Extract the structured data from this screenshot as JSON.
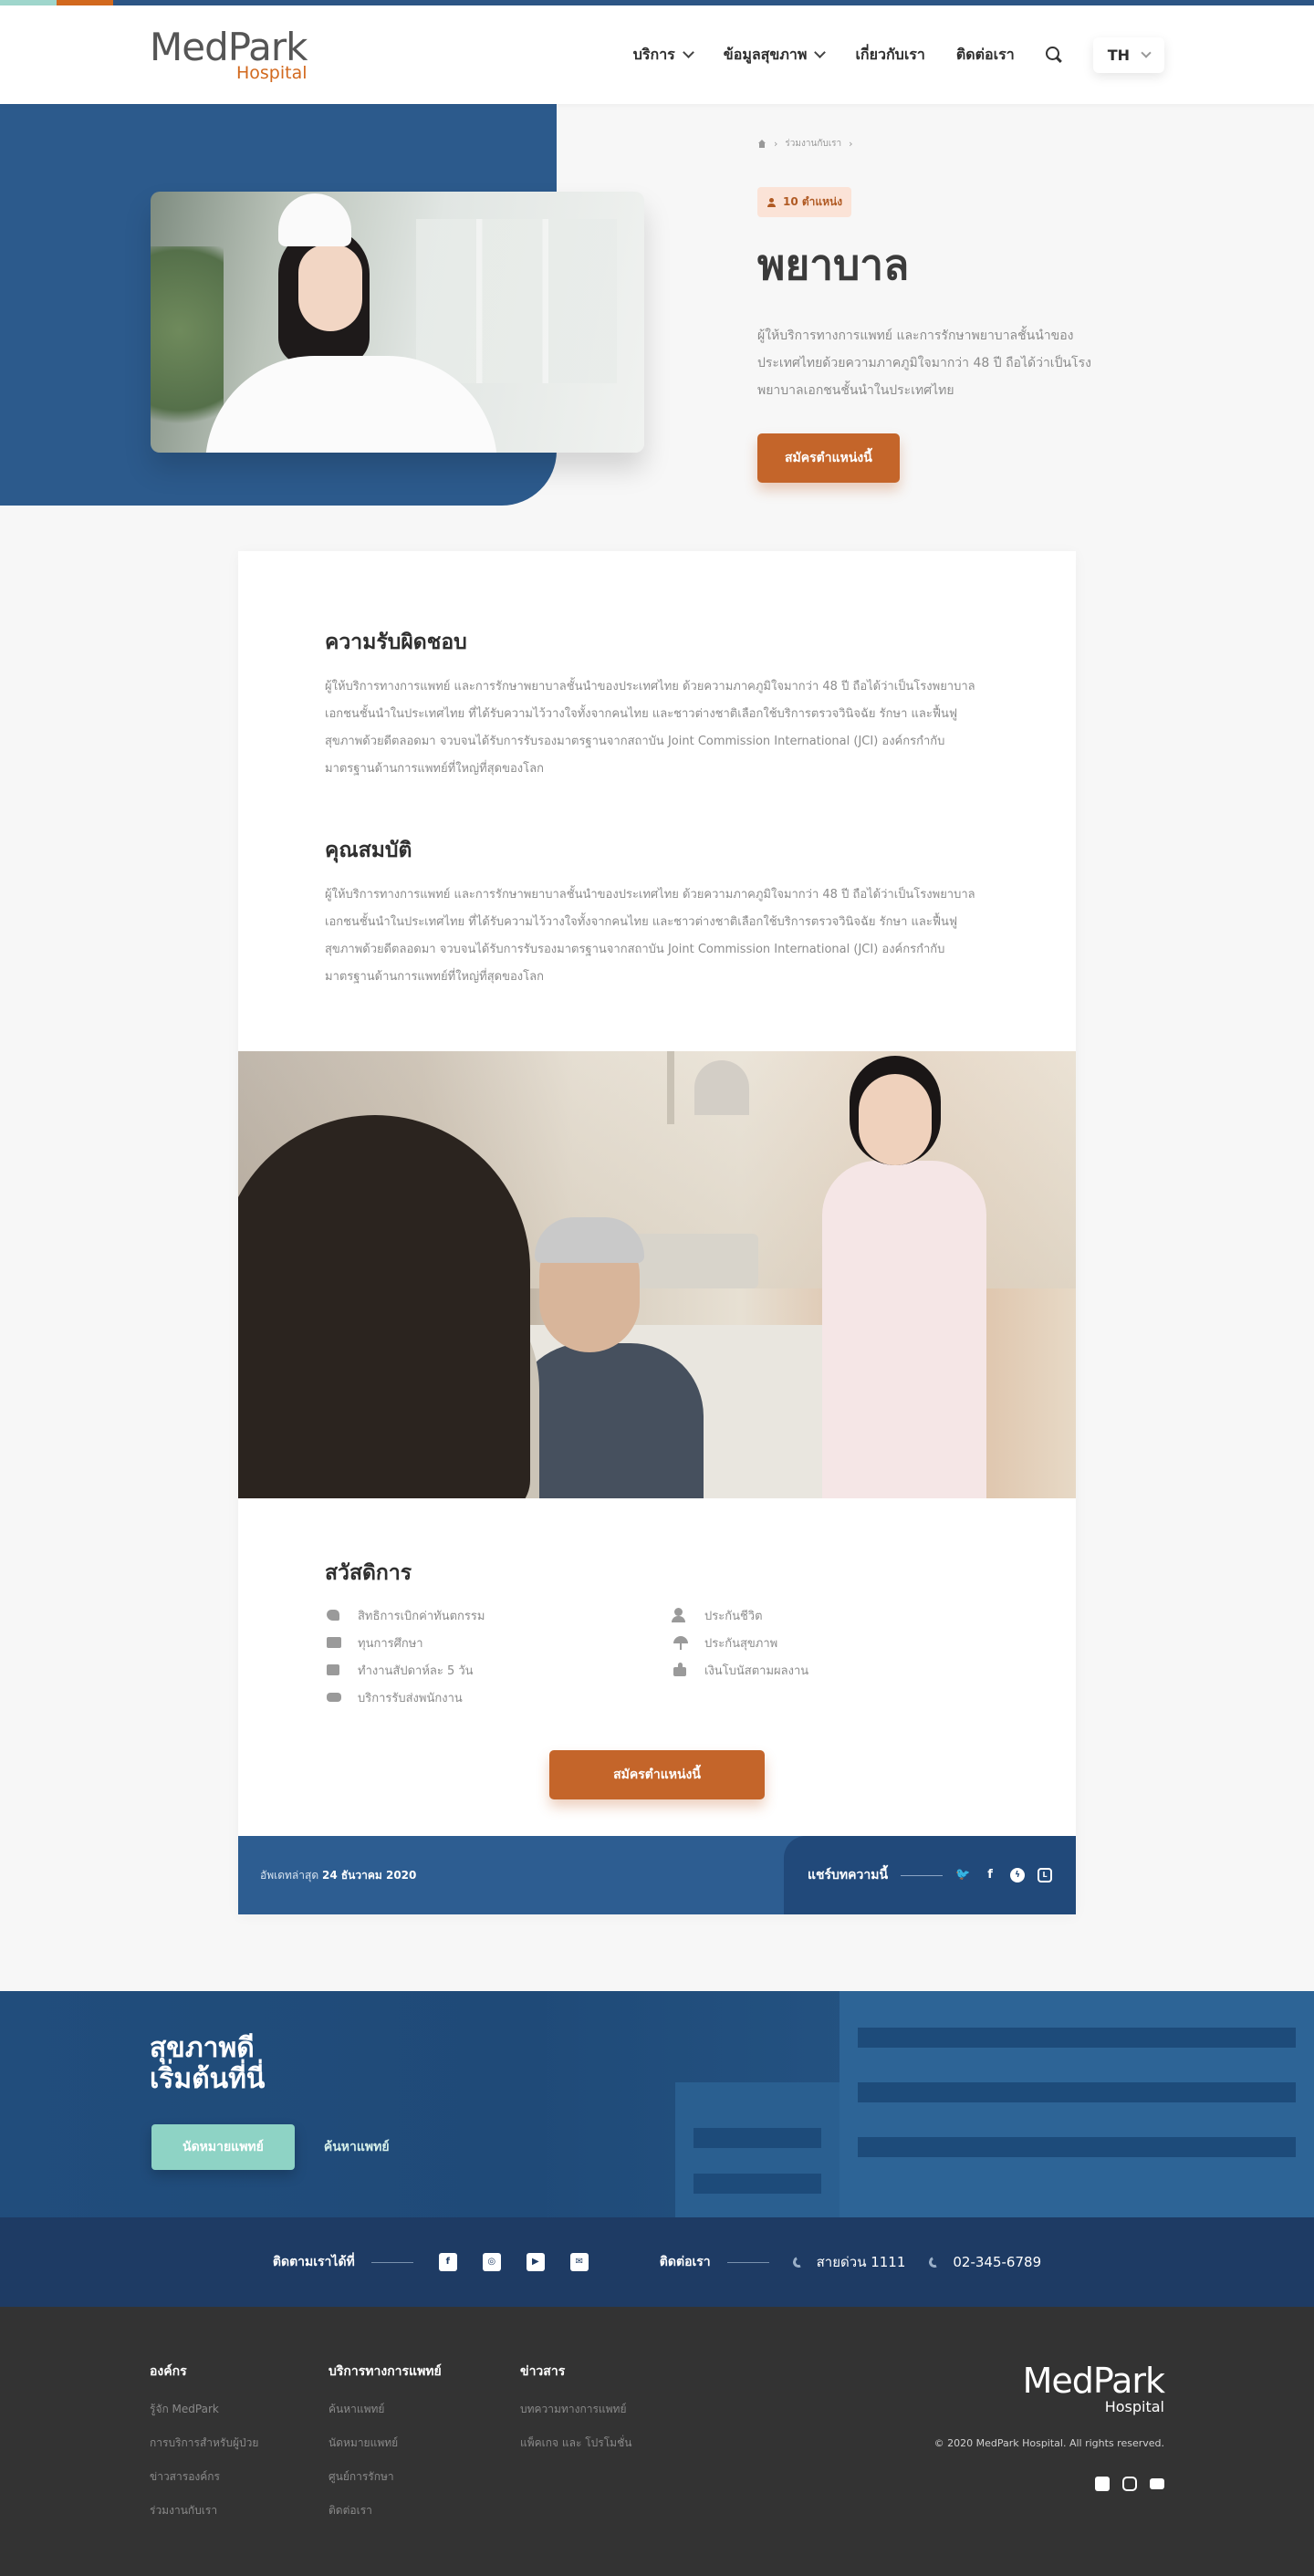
{
  "header": {
    "logo_main": "MedPark",
    "logo_sub": "Hospital",
    "nav": [
      {
        "label": "บริการ"
      },
      {
        "label": "ข้อมูลสุขภาพ"
      },
      {
        "label": "เกี่ยวกับเรา"
      },
      {
        "label": "ติดต่อเรา"
      }
    ],
    "lang": "TH"
  },
  "hero": {
    "breadcrumb": "ร่วมงานกับเรา",
    "badge": "10 ตำแหน่ง",
    "title": "พยาบาล",
    "description": "ผู้ให้บริการทางการแพทย์ และการรักษาพยาบาลชั้นนำของประเทศไทยด้วยความภาคภูมิใจมากว่า 48 ปี ถือได้ว่าเป็นโรงพยาบาลเอกชนชั้นนำในประเทศไทย",
    "apply_button": "สมัครตำแหน่งนี้"
  },
  "content": {
    "responsibility_title": "ความรับผิดชอบ",
    "responsibility_text": "ผู้ให้บริการทางการแพทย์ และการรักษาพยาบาลชั้นนำของประเทศไทย ด้วยความภาคภูมิใจมากว่า 48 ปี ถือได้ว่าเป็นโรงพยาบาลเอกชนชั้นนำในประเทศไทย ที่ได้รับความไว้วางใจทั้งจากคนไทย และชาวต่างชาติเลือกใช้บริการตรวจวินิจฉัย รักษา และฟื้นฟูสุขภาพด้วยดีตลอดมา จวบจนได้รับการรับรองมาตรฐานจากสถาบัน Joint Commission International (JCI) องค์กรกำกับมาตรฐานด้านการแพทย์ที่ใหญ่ที่สุดของโลก",
    "qualification_title": "คุณสมบัติ",
    "qualification_text": "ผู้ให้บริการทางการแพทย์ และการรักษาพยาบาลชั้นนำของประเทศไทย ด้วยความภาคภูมิใจมากว่า 48 ปี ถือได้ว่าเป็นโรงพยาบาลเอกชนชั้นนำในประเทศไทย ที่ได้รับความไว้วางใจทั้งจากคนไทย และชาวต่างชาติเลือกใช้บริการตรวจวินิจฉัย รักษา และฟื้นฟูสุขภาพด้วยดีตลอดมา จวบจนได้รับการรับรองมาตรฐานจากสถาบัน Joint Commission International (JCI) องค์กรกำกับมาตรฐานด้านการแพทย์ที่ใหญ่ที่สุดของโลก",
    "benefits_title": "สวัสดิการ",
    "benefits": [
      {
        "icon": "tooth-icon",
        "label": "สิทธิการเบิกค่าทันตกรรม"
      },
      {
        "icon": "life-insurance-icon",
        "label": "ประกันชีวิต"
      },
      {
        "icon": "book-icon",
        "label": "ทุนการศึกษา"
      },
      {
        "icon": "umbrella-icon",
        "label": "ประกันสุขภาพ"
      },
      {
        "icon": "calendar-icon",
        "label": "ทำงานสัปดาห์ละ 5 วัน"
      },
      {
        "icon": "thumbs-up-icon",
        "label": "เงินโบนัสตามผลงาน"
      },
      {
        "icon": "bus-icon",
        "label": "บริการรับส่งพนักงาน"
      }
    ],
    "apply_button": "สมัครตำแหน่งนี้"
  },
  "share": {
    "updated_label": "อัพเดทล่าสุด",
    "updated_date": "24 ธันวาคม 2020",
    "share_label": "แชร์บทความนี้",
    "icons": [
      "twitter-icon",
      "facebook-icon",
      "messenger-icon",
      "line-icon"
    ]
  },
  "banner": {
    "title_line1": "สุขภาพดี",
    "title_line2": "เริ่มต้นที่นี่",
    "primary_button": "นัดหมายแพทย์",
    "secondary_button": "ค้นหาแพทย์"
  },
  "contact": {
    "follow_label": "ติดตามเราได้ที่",
    "contact_label": "ติดต่อเรา",
    "hotline": "สายด่วน 1111",
    "phone": "02-345-6789"
  },
  "footer": {
    "columns": [
      {
        "title": "องค์กร",
        "links": [
          "รู้จัก MedPark",
          "การบริการสำหรับผู้ป่วย",
          "ข่าวสารองค์กร",
          "ร่วมงานกับเรา"
        ]
      },
      {
        "title": "บริการทางการแพทย์",
        "links": [
          "ค้นหาแพทย์",
          "นัดหมายแพทย์",
          "ศูนย์การรักษา",
          "ติดต่อเรา"
        ]
      },
      {
        "title": "ข่าวสาร",
        "links": [
          "บทความทางการแพทย์",
          "แพ็คเกจ และ โปรโมชั่น"
        ]
      }
    ],
    "logo_main": "MedPark",
    "logo_sub": "Hospital",
    "copyright": "© 2020 MedPark Hospital. All rights reserved."
  }
}
